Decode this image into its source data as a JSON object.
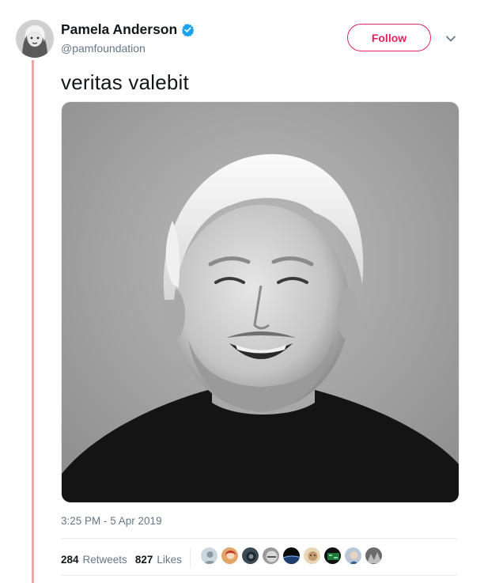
{
  "tweet": {
    "author": {
      "display_name": "Pamela Anderson",
      "handle": "@pamfoundation",
      "verified": true,
      "avatar_icon": "profile-photo"
    },
    "follow_label": "Follow",
    "text": "veritas valebit",
    "photo_description_icon": "photo",
    "timestamp": "3:25 PM - 5 Apr 2019",
    "stats": {
      "retweets_count": "284",
      "retweets_label": "Retweets",
      "likes_count": "827",
      "likes_label": "Likes"
    },
    "likers_count_shown": 10
  },
  "colors": {
    "accent": "#e0245e",
    "verified_blue": "#1da1f2",
    "thread_line": "#e9a9a9",
    "secondary_text": "#657786"
  }
}
